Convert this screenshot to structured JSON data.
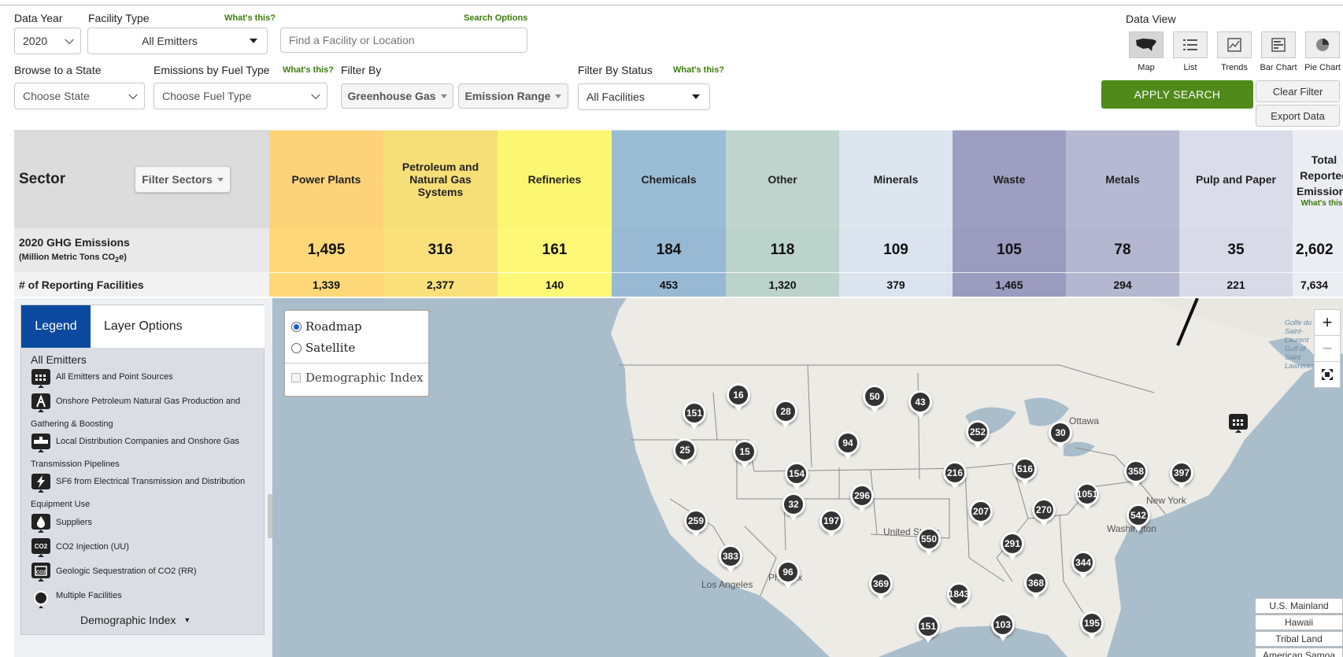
{
  "filters": {
    "data_year_label": "Data Year",
    "data_year_value": "2020",
    "facility_type_label": "Facility Type",
    "facility_type_whats_this": "What's this?",
    "facility_type_value": "All Emitters",
    "search_options_label": "Search Options",
    "search_placeholder": "Find a Facility or Location",
    "browse_state_label": "Browse to a State",
    "browse_state_value": "Choose State",
    "fuel_type_label": "Emissions by Fuel Type",
    "fuel_type_whats_this": "What's this?",
    "fuel_type_value": "Choose Fuel Type",
    "filter_by_label": "Filter By",
    "greenhouse_gas_label": "Greenhouse Gas",
    "emission_range_label": "Emission Range",
    "filter_status_label": "Filter By Status",
    "filter_status_whats_this": "What's this?",
    "filter_status_value": "All Facilities"
  },
  "data_view": {
    "label": "Data View",
    "options": [
      {
        "label": "Map",
        "icon": "usa-map-icon",
        "active": true
      },
      {
        "label": "List",
        "icon": "list-icon",
        "active": false
      },
      {
        "label": "Trends",
        "icon": "trends-icon",
        "active": false
      },
      {
        "label": "Bar Chart",
        "icon": "bar-chart-icon",
        "active": false
      },
      {
        "label": "Pie Chart",
        "icon": "pie-chart-icon",
        "active": false
      }
    ]
  },
  "actions": {
    "apply_search": "APPLY SEARCH",
    "clear_filter": "Clear Filter",
    "export_data": "Export Data"
  },
  "sector_table": {
    "sector_label": "Sector",
    "filter_sectors_label": "Filter Sectors",
    "emissions_label_line1": "2020 GHG Emissions",
    "emissions_label_line2_prefix": "(Million Metric Tons CO",
    "emissions_label_line2_sub": "2",
    "emissions_label_line2_suffix": "e)",
    "facilities_label": "# of Reporting Facilities",
    "columns": [
      {
        "name": "Power Plants",
        "emissions": "1,495",
        "facilities": "1,339",
        "color": "#fed878",
        "head_color": "#fdd37a"
      },
      {
        "name": "Petroleum and Natural Gas Systems",
        "emissions": "316",
        "facilities": "2,377",
        "color": "#f9e07a",
        "head_color": "#f7df78"
      },
      {
        "name": "Refineries",
        "emissions": "161",
        "facilities": "140",
        "color": "#fdf976",
        "head_color": "#fcf772"
      },
      {
        "name": "Chemicals",
        "emissions": "184",
        "facilities": "453",
        "color": "#97b9d4",
        "head_color": "#9abcd5"
      },
      {
        "name": "Other",
        "emissions": "118",
        "facilities": "1,320",
        "color": "#bcd3cc",
        "head_color": "#bed4cd"
      },
      {
        "name": "Minerals",
        "emissions": "109",
        "facilities": "379",
        "color": "#dbe4ee",
        "head_color": "#dde5ee"
      },
      {
        "name": "Waste",
        "emissions": "105",
        "facilities": "1,465",
        "color": "#9b9bc0",
        "head_color": "#9e9ec2"
      },
      {
        "name": "Metals",
        "emissions": "78",
        "facilities": "294",
        "color": "#b5b6d0",
        "head_color": "#b7b8d1"
      },
      {
        "name": "Pulp and Paper",
        "emissions": "35",
        "facilities": "221",
        "color": "#d9dae8",
        "head_color": "#dbdcea"
      },
      {
        "name": "Total Reported Emissions",
        "whats_this": "What's this?",
        "emissions": "2,602",
        "facilities": "7,634",
        "color": "#ececf3",
        "head_color": "#ececf3"
      }
    ]
  },
  "legend": {
    "tab_legend": "Legend",
    "tab_layers": "Layer Options",
    "heading": "All Emitters",
    "items": [
      {
        "label": "All Emitters and Point Sources",
        "icon": "factory-icon"
      },
      {
        "label": "Onshore Petroleum Natural Gas Production and",
        "cont": "Gathering & Boosting",
        "icon": "oil-derrick-icon"
      },
      {
        "label": "Local Distribution Companies and Onshore Gas",
        "cont": "Transmission Pipelines",
        "icon": "pipeline-icon"
      },
      {
        "label": "SF6 from Electrical Transmission and Distribution",
        "cont": "Equipment Use",
        "icon": "lightning-icon"
      },
      {
        "label": "Suppliers",
        "icon": "fuel-drop-icon"
      },
      {
        "label": "CO2 Injection (UU)",
        "icon": "co2-injection-icon"
      },
      {
        "label": "Geologic Sequestration of CO2 (RR)",
        "icon": "co2-sequestration-icon"
      },
      {
        "label": "Multiple Facilities",
        "icon": "multiple-facilities-icon"
      }
    ],
    "demographic_label": "Demographic Index"
  },
  "map": {
    "base_layers": {
      "roadmap": "Roadmap",
      "satellite": "Satellite",
      "selected": "Roadmap",
      "demographic": "Demographic Index"
    },
    "zoom_in": "+",
    "zoom_out": "−",
    "place_labels": {
      "ottawa": "Ottawa",
      "new_york": "New York",
      "united_states": "United States",
      "phoenix": "Phoenix",
      "los_angeles": "Los Angeles",
      "washington": "Washington",
      "gulf": "Golfe du Saint-Laurent Gulf of Saint Lawrence"
    },
    "clusters": [
      "16",
      "151",
      "28",
      "50",
      "43",
      "25",
      "15",
      "94",
      "252",
      "30",
      "154",
      "216",
      "516",
      "358",
      "397",
      "32",
      "296",
      "1051",
      "259",
      "197",
      "207",
      "270",
      "542",
      "550",
      "291",
      "383",
      "96",
      "344",
      "369",
      "1843",
      "368",
      "151",
      "103",
      "195"
    ],
    "regions": [
      "U.S. Mainland",
      "Hawaii",
      "Tribal Land",
      "American Samoa"
    ]
  }
}
